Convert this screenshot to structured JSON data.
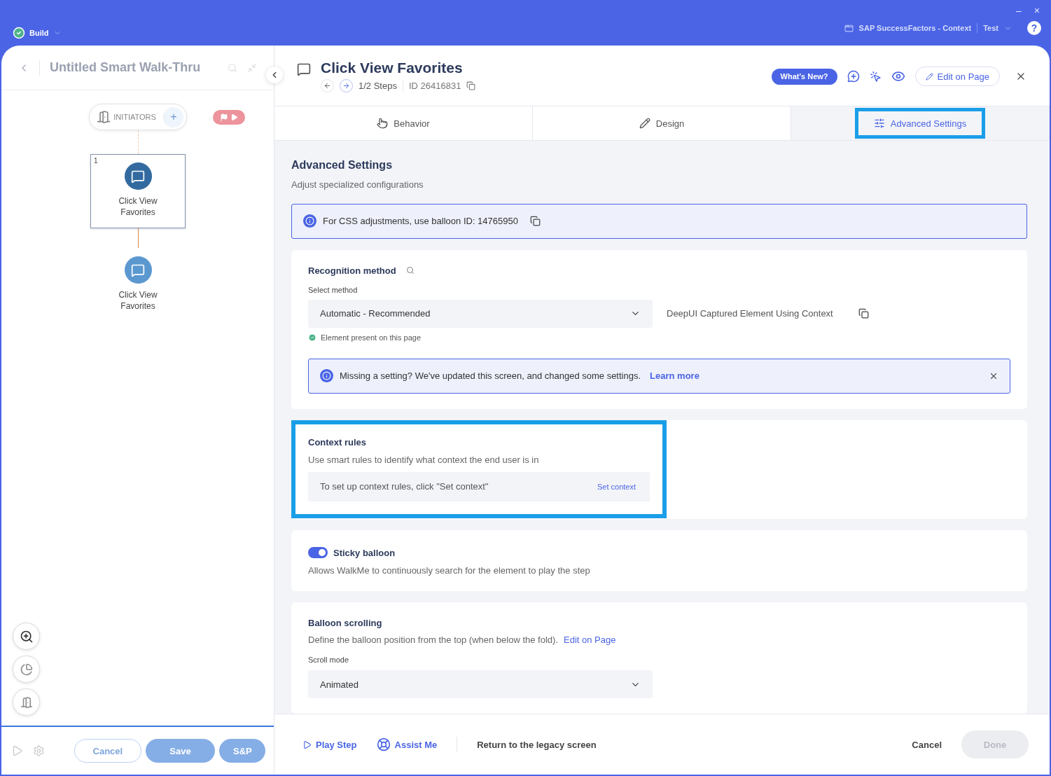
{
  "top_bar": {
    "app": "Build",
    "site": "SAP SuccessFactors - Context",
    "environment": "Test",
    "help": "?",
    "window_controls": [
      "–",
      "×"
    ]
  },
  "left_panel": {
    "title": "Untitled Smart Walk-Thru",
    "initiators": "INITIATORS",
    "add": "+",
    "steps": [
      {
        "number": "1",
        "label": "Click View Favorites",
        "selected": true
      },
      {
        "label": "Click View Favorites",
        "selected": false
      }
    ],
    "buttons": [
      {
        "label": "Cancel",
        "kind": "outline",
        "disabled": true
      },
      {
        "label": "Save",
        "kind": "filled",
        "disabled": true
      },
      {
        "label": "S&P",
        "kind": "filled",
        "disabled": true
      }
    ]
  },
  "header": {
    "title": "Click View Favorites",
    "steps": "1/2 Steps",
    "id": "ID 26416831",
    "whats_new": "What's New?",
    "edit": "Edit on Page"
  },
  "tabs": [
    {
      "label": "Behavior",
      "kind": "behavior",
      "selected": false,
      "highlighted": false
    },
    {
      "label": "Design",
      "kind": "design",
      "selected": false,
      "highlighted": false
    },
    {
      "label": "Advanced Settings",
      "kind": "advanced",
      "selected": true,
      "highlighted": true
    }
  ],
  "content": {
    "heading": "Advanced Settings",
    "subheading": "Adjust specialized configurations",
    "info": "For CSS adjustments, use balloon ID: 14765950",
    "recognition": {
      "title": "Recognition method",
      "select_label": "Select method",
      "select_value": "Automatic - Recommended",
      "element": "DeepUI Captured Element Using Context",
      "status": "Element present on this page",
      "notice": "Missing a setting? We've updated this screen, and changed some settings.",
      "notice_link": "Learn more"
    },
    "context_rules": {
      "title": "Context rules",
      "description": "Use smart rules to identify what context the end user is in",
      "hint": "To set up context rules, click \"Set context\"",
      "action": "Set context",
      "highlighted": true
    },
    "sticky": {
      "title": "Sticky balloon",
      "on": true,
      "description": "Allows WalkMe to continuously search for the element to play the step"
    },
    "scrolling": {
      "title": "Balloon scrolling",
      "description": "Define the balloon position from the top (when below the fold).",
      "link": "Edit on Page",
      "field_label": "Scroll mode",
      "value": "Animated"
    }
  },
  "footer": {
    "play": "Play Step",
    "assist": "Assist Me",
    "legacy": "Return to the legacy screen",
    "cancel": "Cancel",
    "done": "Done",
    "done_disabled": true
  }
}
